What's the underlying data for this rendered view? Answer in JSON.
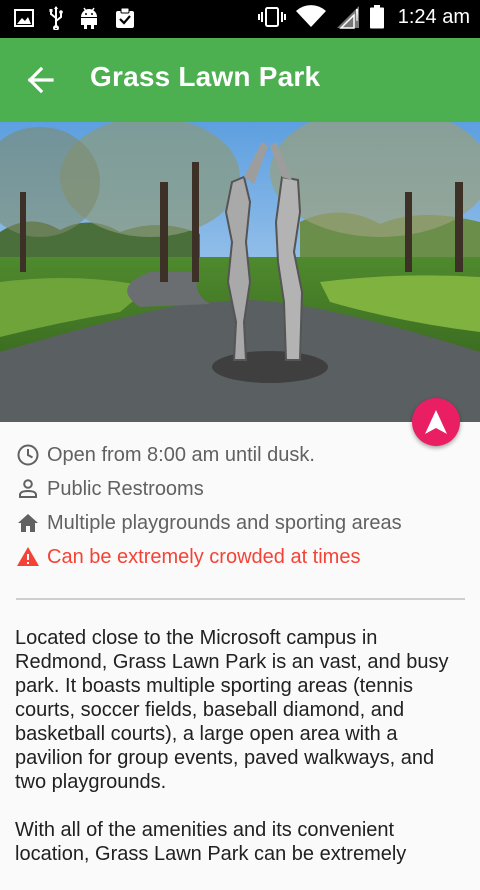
{
  "status_bar": {
    "time": "1:24 am",
    "left_icons": [
      "image-icon",
      "usb-icon",
      "android-icon",
      "clipboard-check-icon"
    ],
    "right_icons": [
      "vibrate-icon",
      "wifi-icon",
      "signal-icon",
      "battery-icon"
    ]
  },
  "app_bar": {
    "title": "Grass Lawn Park",
    "back_icon": "arrow-back-icon",
    "color": "#4caf50"
  },
  "hero": {
    "image": "park-sculpture-photo"
  },
  "fab": {
    "icon": "navigation-icon",
    "color": "#e91e63"
  },
  "info": [
    {
      "icon": "clock-icon",
      "text": "Open from 8:00 am until dusk."
    },
    {
      "icon": "person-icon",
      "text": "Public Restrooms"
    },
    {
      "icon": "home-icon",
      "text": "Multiple playgrounds and sporting areas"
    },
    {
      "icon": "warning-icon",
      "text": "Can be extremely crowded at times",
      "color": "#f44336"
    }
  ],
  "description": {
    "paragraph1": "Located close to the Microsoft campus in Redmond, Grass Lawn Park is an vast, and busy park. It boasts multiple sporting areas (tennis courts, soccer fields, baseball diamond, and basketball courts), a large open area with a pavilion for group events, paved walkways, and two playgrounds.",
    "paragraph2": "With all of the amenities and its convenient location, Grass Lawn Park can be extremely"
  }
}
